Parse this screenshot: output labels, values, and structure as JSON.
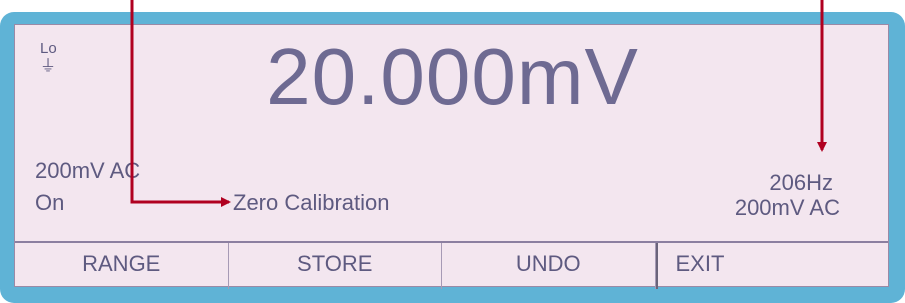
{
  "display": {
    "terminal_label": "Lo",
    "ground_symbol": "⏚",
    "reading": {
      "pre": "2",
      "underlined": "0",
      "post": ".000mV"
    },
    "left_range": "200mV AC",
    "left_state": "On",
    "mode": "Zero  Calibration",
    "frequency": "206Hz",
    "right_range": "200mV AC"
  },
  "softkeys": [
    "RANGE",
    "STORE",
    "UNDO",
    "EXIT"
  ],
  "colors": {
    "bezel": "#5fb3d6",
    "screen": "#f3e6ef",
    "text": "#5e5a80",
    "annotation_arrow": "#b00020"
  }
}
